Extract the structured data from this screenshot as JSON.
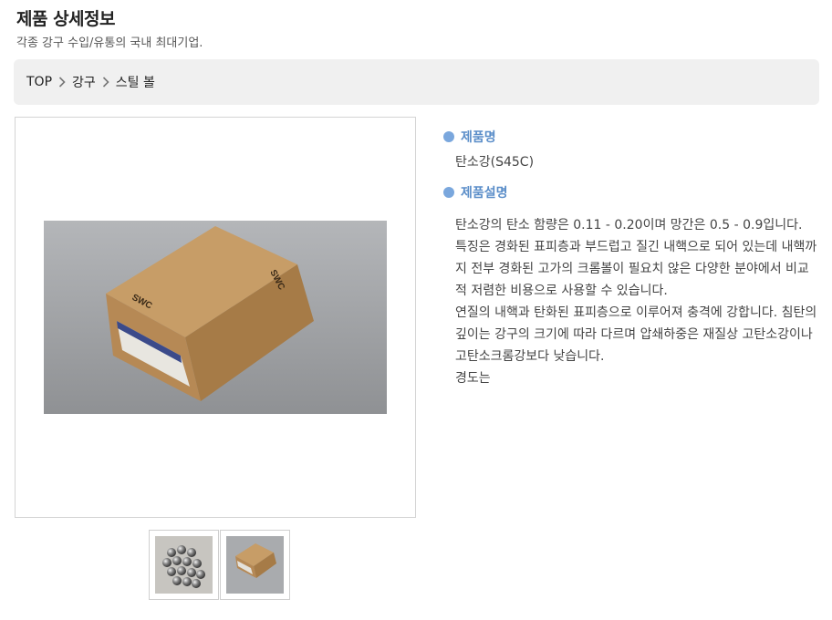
{
  "header": {
    "title": "제품 상세정보",
    "subtitle": "각종 강구 수입/유통의 국내 최대기업."
  },
  "breadcrumb": {
    "items": [
      "TOP",
      "강구",
      "스틸 볼"
    ]
  },
  "product": {
    "name_label": "제품명",
    "name_value": "탄소강(S45C)",
    "desc_label": "제품설명",
    "desc_paragraphs": [
      "탄소강의 탄소 함량은 0.11 - 0.20이며 망간은 0.5 - 0.9입니다.",
      "특징은 경화된 표피층과 부드럽고 질긴 내핵으로 되어 있는데 내핵까지 전부 경화된 고가의 크롬볼이 필요치 않은 다양한 분야에서 비교적 저렴한 비용으로 사용할 수 있습니다.",
      "연질의 내핵과 탄화된 표피층으로 이루어져 충격에 강합니다. 침탄의 깊이는 강구의 크기에 따라 다르며 압쇄하중은 재질상 고탄소강이나 고탄소크롬강보다 낮습니다.",
      "경도는"
    ]
  },
  "images": {
    "box_print": "SWC"
  },
  "colors": {
    "accent": "#5b8ec9",
    "bullet": "#7aa7dd",
    "breadcrumb_bg": "#f0f0f0"
  }
}
